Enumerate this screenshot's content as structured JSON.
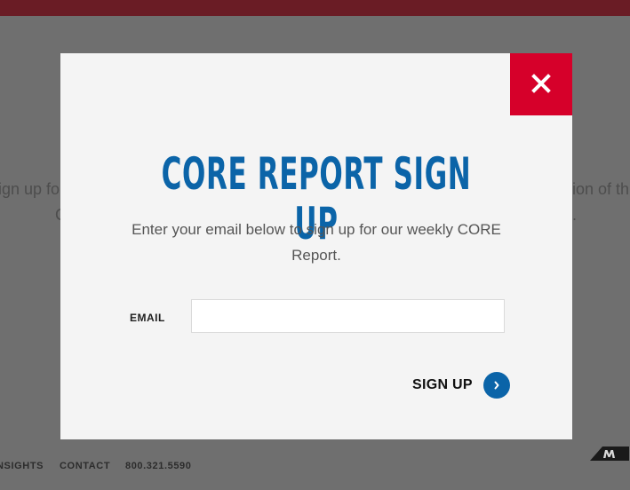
{
  "background": {
    "left_text_line1": "ign up fo",
    "left_text_line2": "C",
    "right_text_line1": "ion of th",
    "right_text_line2": "."
  },
  "footer": {
    "links": [
      "NSIGHTS",
      "CONTACT",
      "800.321.5590"
    ],
    "logo_icon": "brand-m-logo-icon"
  },
  "modal": {
    "title": "CORE REPORT SIGN UP",
    "description": "Enter your email below to sign up for our weekly CORE Report.",
    "email_label": "EMAIL",
    "email_value": "",
    "email_placeholder": "",
    "signup_label": "SIGN UP",
    "close_icon": "close-icon",
    "arrow_icon": "chevron-right-icon"
  },
  "colors": {
    "accent_blue": "#0b64a8",
    "close_red": "#d6002a",
    "top_bar": "#6a1c25",
    "overlay": "#6f6f6f"
  }
}
